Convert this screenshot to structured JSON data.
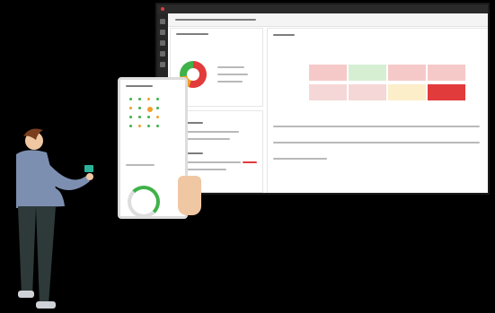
{
  "scene": {
    "background": "#000000",
    "accent_red": "#e23b3b",
    "accent_green": "#3fb24a",
    "accent_orange": "#f0a02a",
    "teal_phone": "#2bb39a"
  },
  "monitor": {
    "status_colors": [
      "#f6c9c9",
      "#d6efd3",
      "#f6c9c9",
      "#f6c9c9",
      "#f6c9c9",
      "#f6c9c9",
      "#f6d7d7",
      "#f6d7d7",
      "#f6d7d7",
      "#fbeec9",
      "#e23b3b",
      "#f6d7d7"
    ]
  },
  "icons": [
    "donut-chart-icon",
    "gauge-icon",
    "smartphone-icon"
  ]
}
